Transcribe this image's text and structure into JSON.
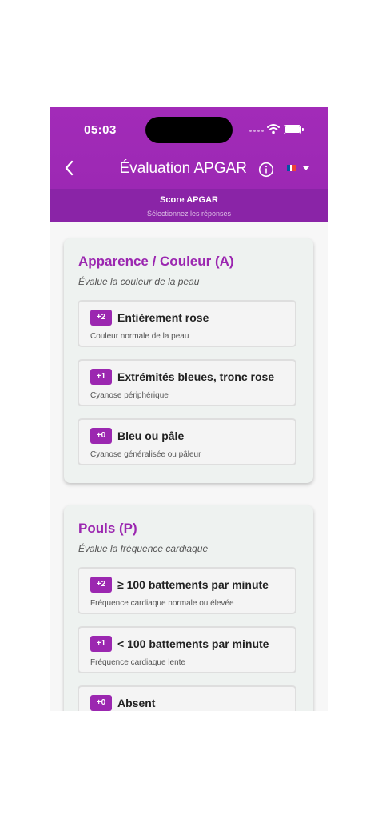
{
  "status_bar": {
    "time": "05:03"
  },
  "header": {
    "title": "Évaluation APGAR",
    "back_icon": "chevron-left-icon",
    "info_icon": "info-circle-icon",
    "language_flag": "flag-fr-icon",
    "flag_colors": [
      "#0055a4",
      "#ffffff",
      "#ef4135"
    ],
    "score_title": "Score APGAR",
    "score_subtitle": "Sélectionnez les réponses"
  },
  "colors": {
    "accent": "#9b27b0",
    "header_bg": "#a22bb8",
    "score_bar_bg": "#8a24a7"
  },
  "sections": [
    {
      "title": "Apparence / Couleur (A)",
      "description": "Évalue la couleur de la peau",
      "options": [
        {
          "badge": "+2",
          "label": "Entièrement rose",
          "sub": "Couleur normale de la peau"
        },
        {
          "badge": "+1",
          "label": "Extrémités bleues, tronc rose",
          "sub": "Cyanose périphérique"
        },
        {
          "badge": "+0",
          "label": "Bleu ou pâle",
          "sub": "Cyanose généralisée ou pâleur"
        }
      ]
    },
    {
      "title": "Pouls (P)",
      "description": "Évalue la fréquence cardiaque",
      "options": [
        {
          "badge": "+2",
          "label": "≥ 100 battements par minute",
          "sub": "Fréquence cardiaque normale ou élevée"
        },
        {
          "badge": "+1",
          "label": "< 100 battements par minute",
          "sub": "Fréquence cardiaque lente"
        },
        {
          "badge": "+0",
          "label": "Absent",
          "sub": ""
        }
      ]
    }
  ]
}
